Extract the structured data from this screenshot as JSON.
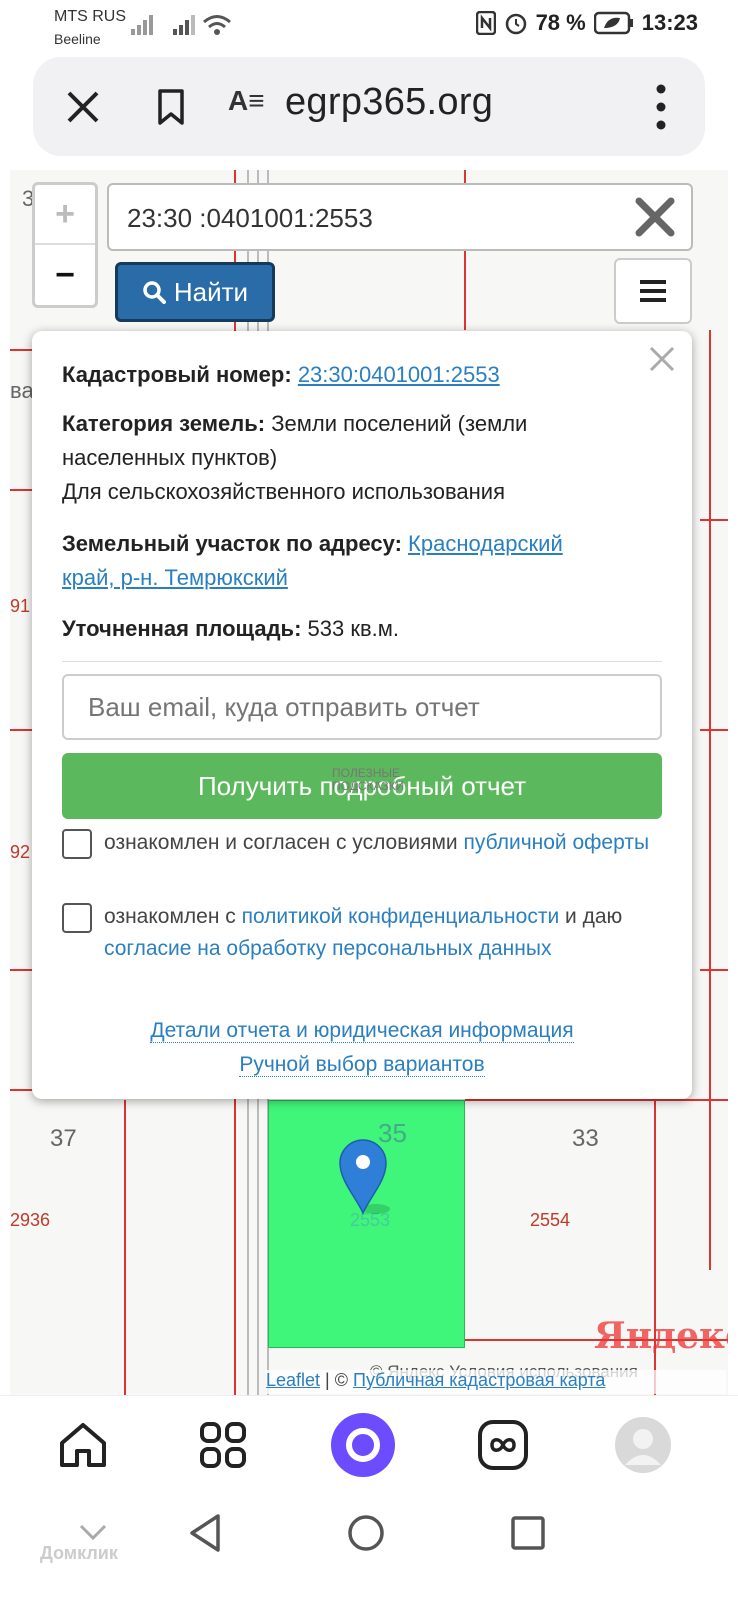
{
  "status": {
    "carrier1": "MTS RUS",
    "carrier2": "Beeline",
    "battery": "78 %",
    "time": "13:23"
  },
  "browser": {
    "host": "egrp365.org",
    "reader_glyph": "A≡"
  },
  "map": {
    "labels": [
      "3",
      "ва",
      "91",
      "92",
      "37",
      "35",
      "33"
    ],
    "parcel_numbers": [
      "2936",
      "2553",
      "2554"
    ],
    "watermark": "Яндекс",
    "attribution_yandex": "© Яндекс Условия использования",
    "attribution_leaflet": "Leaflet",
    "attribution_sep": " | © ",
    "attribution_pkk": "Публичная кадастровая карта"
  },
  "search": {
    "value": "23:30 :0401001:2553",
    "find_label": "Найти"
  },
  "popup": {
    "cadastral_label": "Кадастровый номер:",
    "cadastral_value": "23:30:0401001:2553",
    "category_label": "Категория земель:",
    "category_value_1": "Земли поселений (земли",
    "category_value_2": "населенных пунктов)",
    "category_use": "Для сельскохозяйственного использования",
    "address_label": "Земельный участок по адресу:",
    "address_value_1": "Краснодарский",
    "address_value_2": "край, р-н. Темрюкский",
    "area_label": "Уточненная площадь:",
    "area_value": "533 кв.м.",
    "email_placeholder": "Ваш email, куда отправить отчет",
    "get_report_label": "Получить подробный отчет",
    "watermark_1": "ПОЛЕЗНЫЕ",
    "watermark_2": "ПОДСКАЗКИ",
    "consent1_text": "ознакомлен и согласен с условиями ",
    "consent1_link": "публичной оферты",
    "consent2_text1": "ознакомлен с ",
    "consent2_link1": "политикой конфиденциальности",
    "consent2_text2": " и даю ",
    "consent2_link2": "согласие на обработку персональных данных",
    "details_link": "Детали отчета и юридическая информация",
    "manual_link": "Ручной выбор вариантов"
  },
  "footer_watermark": "Домклик",
  "colors": {
    "parcel": "#3ff57a",
    "find_button": "#2a6ca8",
    "report_button": "#5cb85c",
    "link": "#2a7fc0",
    "alice": "#6b4cff"
  }
}
